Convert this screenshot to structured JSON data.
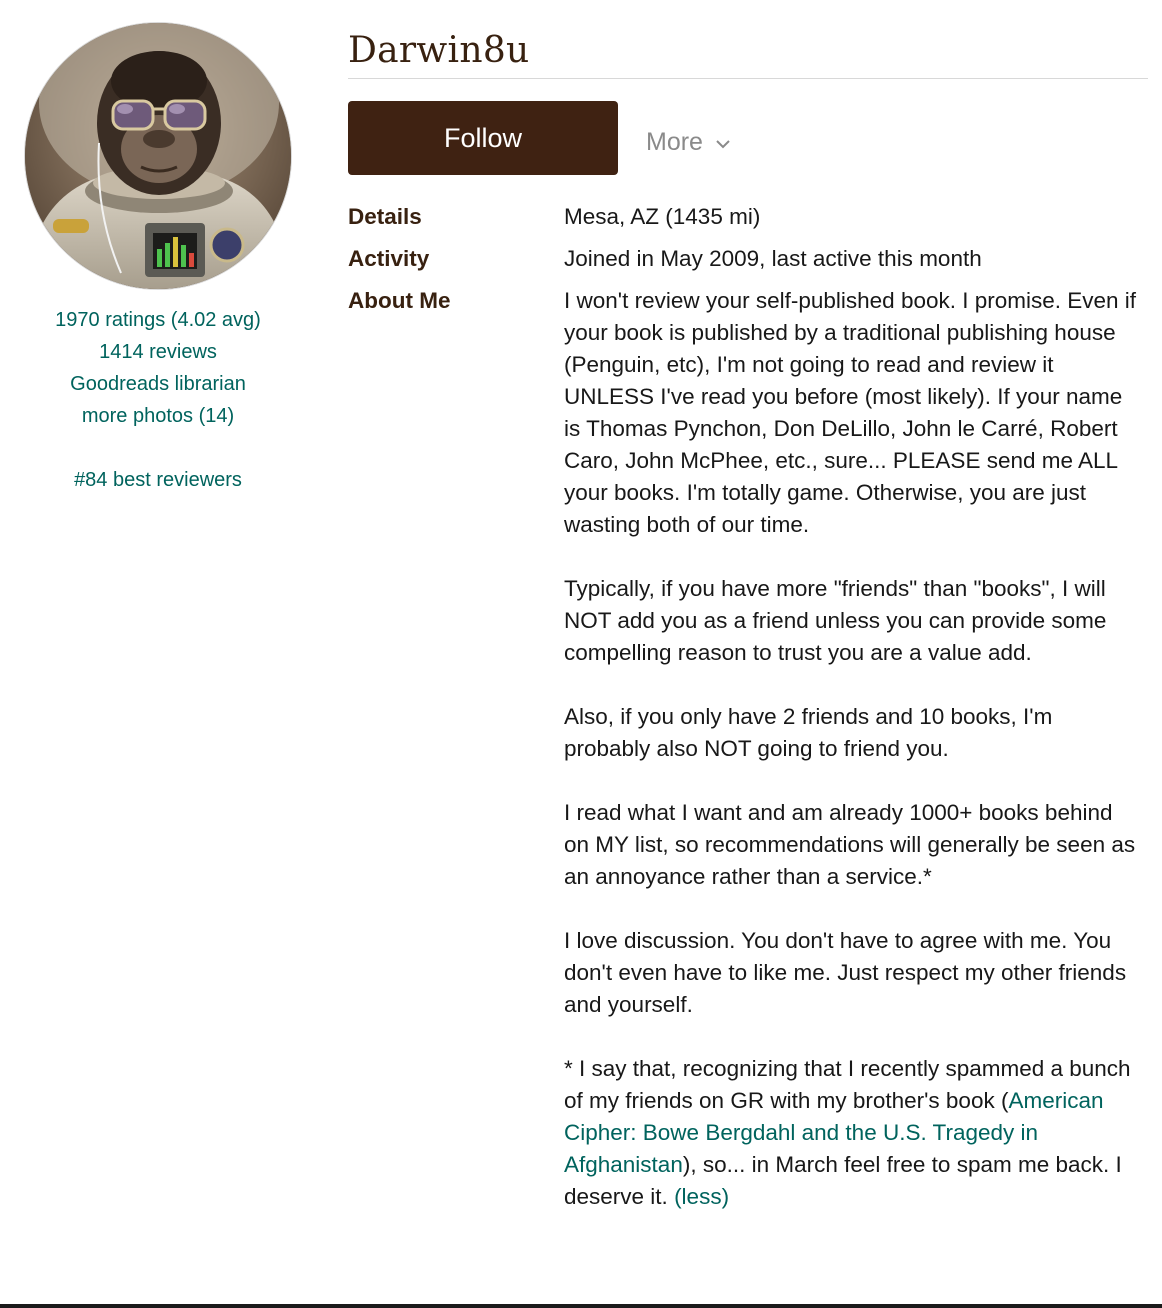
{
  "profile": {
    "name": "Darwin8u",
    "stats": {
      "ratings": "1970 ratings (4.02 avg)",
      "reviews": "1414 reviews",
      "librarian": "Goodreads librarian",
      "photos": "more photos (14)",
      "rank": "#84 best reviewers"
    }
  },
  "actions": {
    "follow_label": "Follow",
    "more_label": "More"
  },
  "details": {
    "details_label": "Details",
    "details_value": "Mesa, AZ (1435 mi)",
    "activity_label": "Activity",
    "activity_value": "Joined in May 2009, last active this month",
    "about_label": "About Me",
    "about": {
      "p1": "I won't review your self-published book. I promise. Even if your book is published by a traditional publishing house (Penguin, etc), I'm not going to read and review it UNLESS I've read you before (most likely). If your name is Thomas Pynchon, Don DeLillo, John le Carré, Robert Caro, John McPhee, etc., sure... PLEASE send me ALL your books. I'm totally game. Otherwise, you are just wasting both of our time.",
      "p2": "Typically, if you have more \"friends\" than \"books\", I will NOT add you as a friend unless you can provide some compelling reason to trust you are a value add.",
      "p3": "Also, if you only have 2 friends and 10 books, I'm probably also NOT going to friend you.",
      "p4": "I read what I want and am already 1000+ books behind on MY list, so recommendations will generally be seen as an annoyance rather than a service.*",
      "p5": "I love discussion. You don't have to agree with me. You don't even have to like me. Just respect my other friends and yourself.",
      "p6_before": "* I say that, recognizing that I recently spammed a bunch of my friends on GR with my brother's book (",
      "p6_link": "American Cipher: Bowe Bergdahl and the U.S. Tragedy in Afghanistan",
      "p6_after": "), so... in March feel free to spam me back. I deserve it. ",
      "less_label": "(less)"
    }
  },
  "icons": {
    "chevron": "chevron-down-icon",
    "avatar": "profile-photo"
  },
  "colors": {
    "brand_dark": "#382110",
    "button_bg": "#3f2212",
    "link": "#00635d",
    "muted": "#8a8a8a"
  }
}
